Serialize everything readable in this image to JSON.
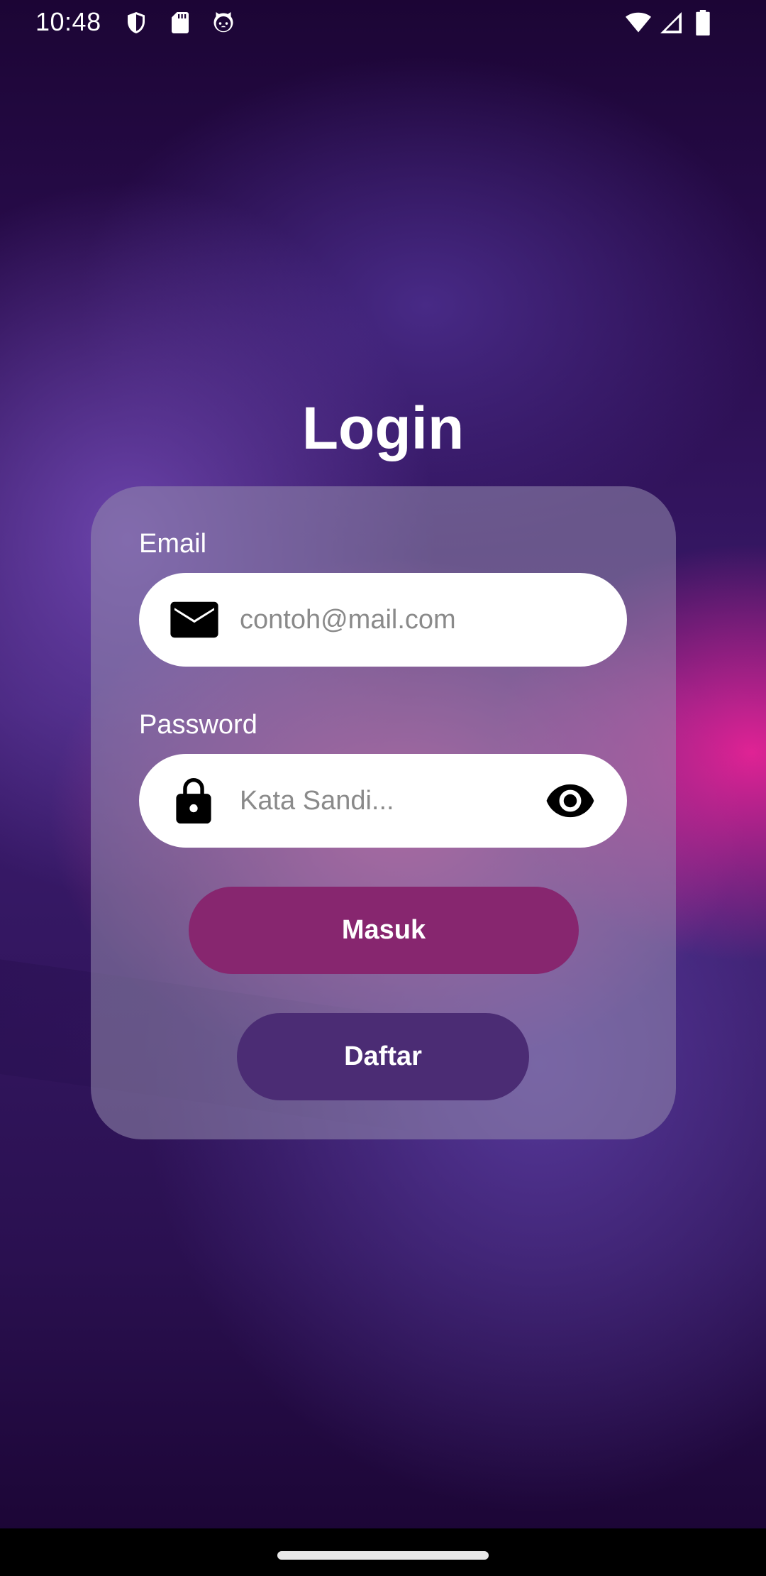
{
  "status_bar": {
    "time": "10:48",
    "left_icons": [
      "shield-icon",
      "sd-card-icon",
      "cat-face-icon"
    ],
    "right_icons": [
      "wifi-icon",
      "cell-signal-icon",
      "battery-icon"
    ]
  },
  "login": {
    "title": "Login",
    "email": {
      "label": "Email",
      "placeholder": "contoh@mail.com",
      "icon": "mail-icon"
    },
    "password": {
      "label": "Password",
      "placeholder": "Kata Sandi...",
      "icon": "lock-icon",
      "toggle_icon": "eye-icon"
    },
    "masuk_label": "Masuk",
    "daftar_label": "Daftar"
  },
  "colors": {
    "masuk_button": "#87266f",
    "daftar_button": "#4b2c74",
    "card": "rgba(150,140,175,0.55)",
    "background": "#1c0535"
  }
}
